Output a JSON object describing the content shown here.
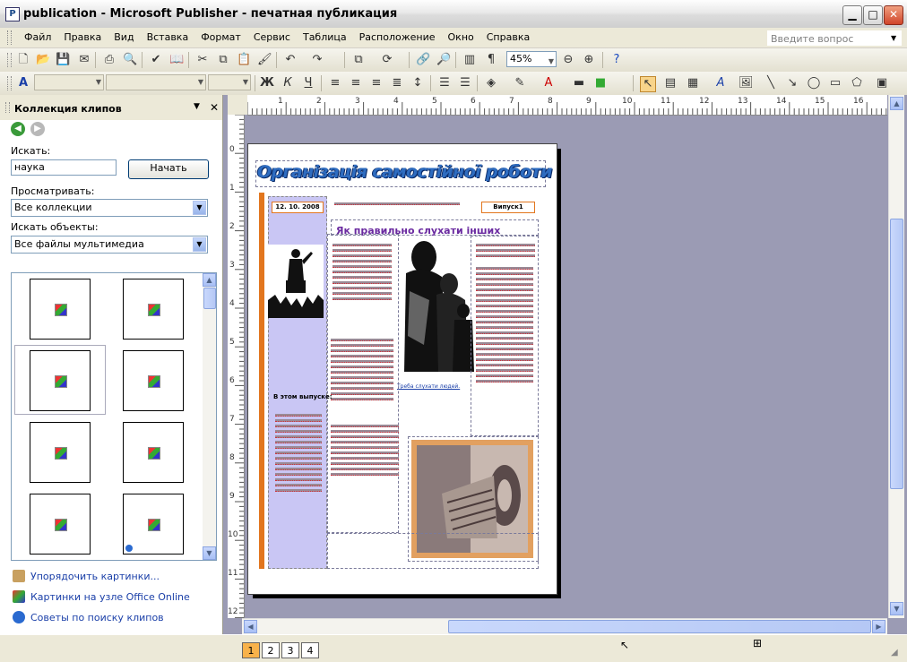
{
  "window": {
    "title": "publication - Microsoft Publisher - печатная публикация",
    "app_icon": "publisher-icon"
  },
  "menu": {
    "items": [
      "Файл",
      "Правка",
      "Вид",
      "Вставка",
      "Формат",
      "Сервис",
      "Таблица",
      "Расположение",
      "Окно",
      "Справка"
    ],
    "help_placeholder": "Введите вопрос"
  },
  "toolbar": {
    "zoom": "45%"
  },
  "taskpane": {
    "title": "Коллекция клипов",
    "search_label": "Искать:",
    "search_value": "наука",
    "go_button": "Начать",
    "browse_label": "Просматривать:",
    "browse_value": "Все коллекции",
    "types_label": "Искать объекты:",
    "types_value": "Все файлы мультимедиа",
    "links": [
      "Упорядочить картинки...",
      "Картинки на узле Office Online",
      "Советы по поиску клипов"
    ]
  },
  "rulers": {
    "top": [
      "1",
      "2",
      "3",
      "4",
      "5",
      "6",
      "7",
      "8",
      "9",
      "10",
      "11",
      "12",
      "13",
      "14",
      "15",
      "16"
    ],
    "left": [
      "0",
      "1",
      "2",
      "3",
      "4",
      "5",
      "6",
      "7",
      "8",
      "9",
      "10",
      "11",
      "12"
    ]
  },
  "document": {
    "title": "Організація самостійної роботи студентів",
    "date": "12. 10. 2008",
    "issue": "Випуск1",
    "article_title": "Як правильно слухати інших",
    "contents_title": "В этом выпуске:",
    "photo_caption": "Треба слухати людей."
  },
  "pages": [
    "1",
    "2",
    "3",
    "4"
  ],
  "colors": {
    "title_blue": "#2e6cc0",
    "accent_orange": "#e2761e",
    "sidebar_lavender": "#c9c6f4",
    "workspace": "#9b9bb4"
  }
}
